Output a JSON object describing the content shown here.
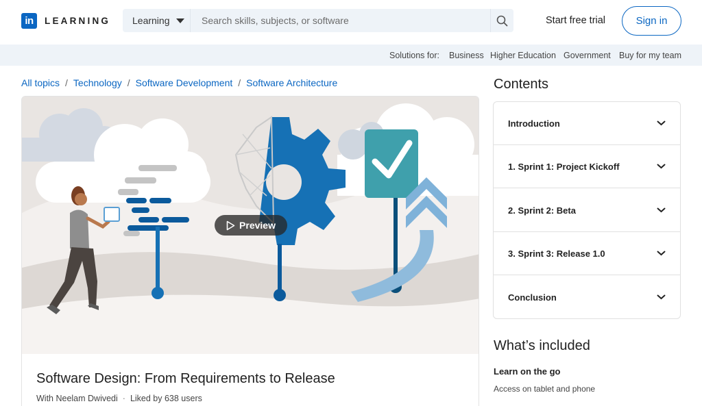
{
  "header": {
    "logo_mark": "in",
    "logo_text": "LEARNING",
    "search_category": "Learning",
    "search_placeholder": "Search skills, subjects, or software",
    "trial_label": "Start free trial",
    "signin_label": "Sign in"
  },
  "solutions": {
    "label": "Solutions for:",
    "links": [
      "Business",
      "Higher Education",
      "Government",
      "Buy for my team"
    ]
  },
  "breadcrumb": [
    "All topics",
    "Technology",
    "Software Development",
    "Software Architecture"
  ],
  "course": {
    "preview_label": "Preview",
    "title": "Software Design: From Requirements to Release",
    "author": "With Neelam Dwivedi",
    "likes": "Liked by 638 users"
  },
  "contents": {
    "heading": "Contents",
    "items": [
      "Introduction",
      "1. Sprint 1: Project Kickoff",
      "2. Sprint 2: Beta",
      "3. Sprint 3: Release 1.0",
      "Conclusion"
    ]
  },
  "included": {
    "heading": "What’s included",
    "item_title": "Learn on the go",
    "item_desc": "Access on tablet and phone"
  },
  "colors": {
    "brand": "#0a66c2",
    "bar_bg": "#eef3f8"
  },
  "icons": [
    "linkedin-logo-icon",
    "caret-down-icon",
    "search-icon",
    "play-icon",
    "chevron-down-icon"
  ]
}
